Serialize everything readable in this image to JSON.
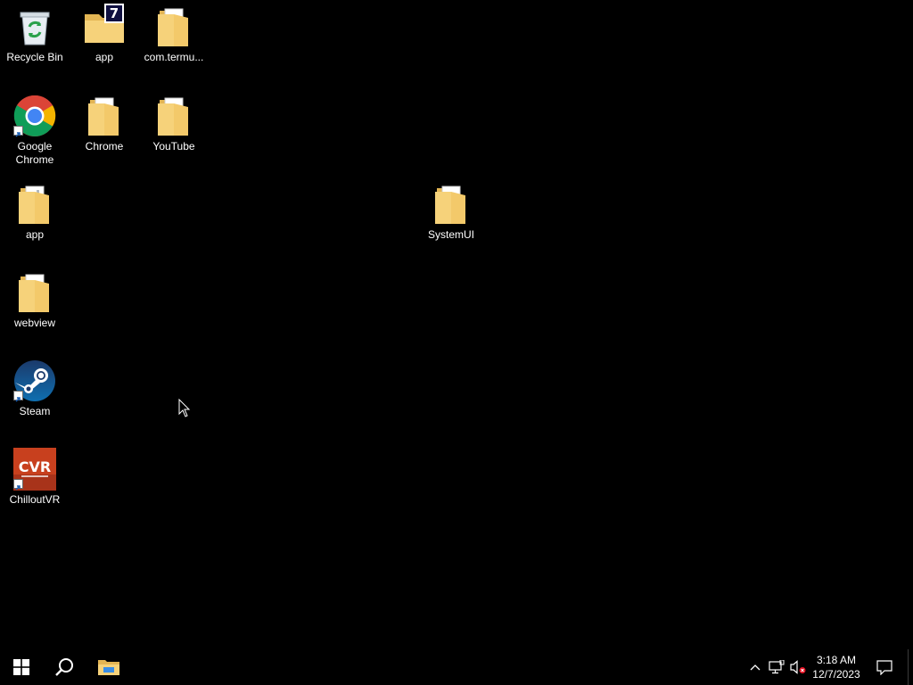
{
  "desktop": {
    "background_color": "#000000",
    "icons": {
      "recycle_bin": {
        "label": "Recycle Bin",
        "icon": "recycle-bin-icon"
      },
      "app_top": {
        "label": "app",
        "icon": "folder-7zip-icon",
        "badge": "7"
      },
      "com_termux": {
        "label": "com.termu...",
        "icon": "folder-icon"
      },
      "google_chrome": {
        "label": "Google Chrome",
        "icon": "chrome-icon"
      },
      "chrome_folder": {
        "label": "Chrome",
        "icon": "folder-icon"
      },
      "youtube_folder": {
        "label": "YouTube",
        "icon": "folder-icon"
      },
      "app_folder": {
        "label": "app",
        "icon": "folder-icon"
      },
      "systemui_folder": {
        "label": "SystemUI",
        "icon": "folder-icon"
      },
      "webview_folder": {
        "label": "webview",
        "icon": "folder-icon"
      },
      "steam": {
        "label": "Steam",
        "icon": "steam-icon"
      },
      "chilloutvr": {
        "label": "ChilloutVR",
        "icon": "chilloutvr-icon",
        "logo_text": "CVR"
      }
    }
  },
  "taskbar": {
    "start": {
      "icon": "windows-start-icon"
    },
    "search": {
      "icon": "search-icon"
    },
    "file_explorer": {
      "icon": "file-explorer-icon"
    },
    "tray": {
      "chevron": {
        "icon": "chevron-up-icon"
      },
      "network": {
        "icon": "network-icon"
      },
      "volume": {
        "icon": "volume-muted-icon"
      }
    },
    "clock": {
      "time": "3:18 AM",
      "date": "12/7/2023"
    },
    "notifications": {
      "icon": "action-center-icon"
    }
  },
  "colors": {
    "folder": "#f6d27a",
    "folder_dark": "#e3b553",
    "accent_blue": "#1e90ff",
    "steam_blue": "#1b2838",
    "chilloutvr_red": "#c8401e"
  }
}
